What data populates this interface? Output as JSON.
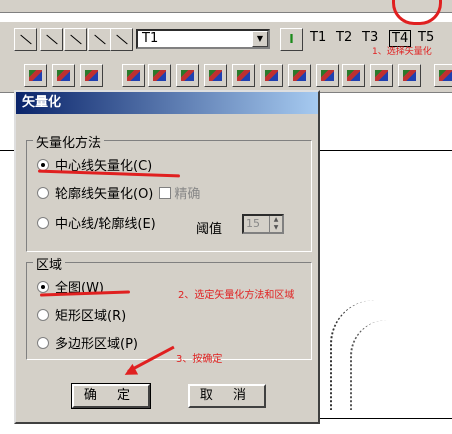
{
  "toolbar": {
    "layer_value": "T1",
    "layer_tabs": [
      "T1",
      "T2",
      "T3",
      "T4",
      "T5"
    ],
    "top_annotation": "1、选择矢量化"
  },
  "dialog": {
    "title": "矢量化",
    "method_group": {
      "legend": "矢量化方法",
      "options": [
        "中心线矢量化(C)",
        "轮廓线矢量化(O)",
        "中心线/轮廓线(E)"
      ],
      "selected": "中心线矢量化(C)",
      "checkbox_label": "精确",
      "threshold_label": "阈值",
      "threshold_value": "15"
    },
    "region_group": {
      "legend": "区域",
      "options": [
        "全图(W)",
        "矩形区域(R)",
        "多边形区域(P)"
      ],
      "selected": "全图(W)"
    },
    "ok_label": "确 定",
    "cancel_label": "取 消"
  },
  "annotations": {
    "step2": "2、选定矢量化方法和区域",
    "step3": "3、按确定"
  },
  "colors": {
    "annotation": "#e02020",
    "titlebar": "#0a246a",
    "dialog_bg": "#d4d0c8"
  }
}
